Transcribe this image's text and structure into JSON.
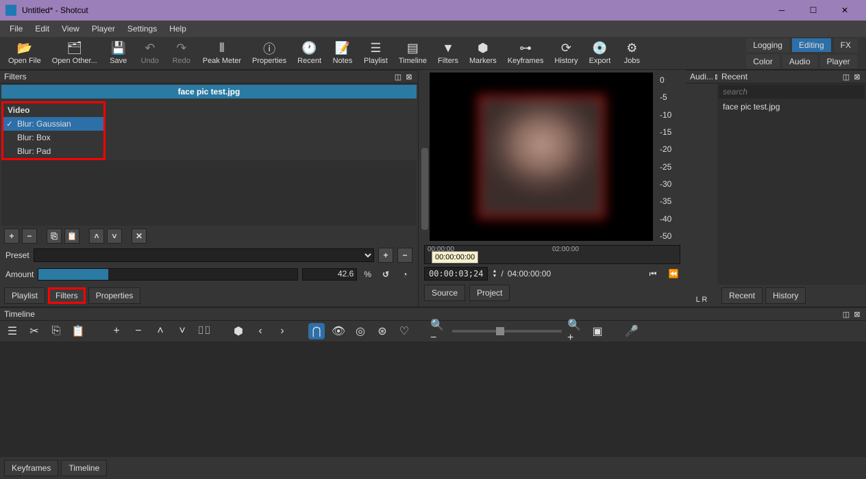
{
  "title": "Untitled* - Shotcut",
  "menu": [
    "File",
    "Edit",
    "View",
    "Player",
    "Settings",
    "Help"
  ],
  "toolbar": [
    {
      "icon": "folder-open",
      "label": "Open File"
    },
    {
      "icon": "folder-plus",
      "label": "Open Other..."
    },
    {
      "icon": "save",
      "label": "Save"
    },
    {
      "icon": "undo",
      "label": "Undo",
      "dim": true
    },
    {
      "icon": "redo",
      "label": "Redo",
      "dim": true
    },
    {
      "icon": "bars",
      "label": "Peak Meter"
    },
    {
      "icon": "info",
      "label": "Properties"
    },
    {
      "icon": "clock",
      "label": "Recent"
    },
    {
      "icon": "note",
      "label": "Notes"
    },
    {
      "icon": "list",
      "label": "Playlist"
    },
    {
      "icon": "timeline",
      "label": "Timeline"
    },
    {
      "icon": "funnel",
      "label": "Filters"
    },
    {
      "icon": "shield",
      "label": "Markers"
    },
    {
      "icon": "keyframes",
      "label": "Keyframes"
    },
    {
      "icon": "history",
      "label": "History"
    },
    {
      "icon": "disc",
      "label": "Export"
    },
    {
      "icon": "gear",
      "label": "Jobs"
    }
  ],
  "right_tabs": {
    "row1": [
      "Logging",
      "Editing",
      "FX"
    ],
    "row2": [
      "Color",
      "Audio",
      "Player"
    ],
    "active": "Editing"
  },
  "filters_panel": {
    "title": "Filters",
    "clip": "face pic test.jpg",
    "category": "Video",
    "items": [
      {
        "label": "Blur: Gaussian",
        "checked": true,
        "selected": true
      },
      {
        "label": "Blur: Box",
        "checked": false,
        "selected": false
      },
      {
        "label": "Blur: Pad",
        "checked": false,
        "selected": false
      }
    ],
    "preset_label": "Preset",
    "amount_label": "Amount",
    "amount_value": "42.6",
    "amount_pct": "%",
    "tabs": [
      "Playlist",
      "Filters",
      "Properties"
    ],
    "active_tab": "Filters"
  },
  "preview": {
    "scale": [
      "0",
      "-5",
      "-10",
      "-15",
      "-20",
      "-25",
      "-30",
      "-35",
      "-40",
      "-50"
    ],
    "ruler": [
      "00:00:00",
      "02:00:00"
    ],
    "tooltip": "00:00:00:00",
    "current": "00:00:03;24",
    "total": "04:00:00:00",
    "lr": "L   R",
    "src_tabs": [
      "Source",
      "Project"
    ]
  },
  "audio_label": "Audi...",
  "recent_panel": {
    "title": "Recent",
    "placeholder": "search",
    "items": [
      "face pic test.jpg"
    ],
    "tabs": [
      "Recent",
      "History"
    ]
  },
  "timeline": {
    "title": "Timeline",
    "tabs": [
      "Keyframes",
      "Timeline"
    ]
  }
}
